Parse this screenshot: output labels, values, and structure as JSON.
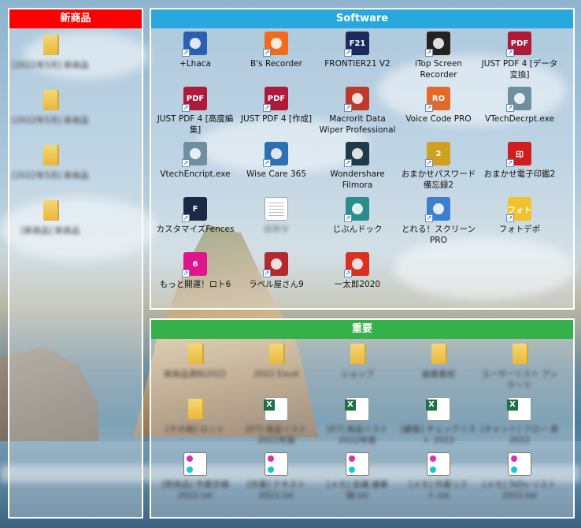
{
  "fences": {
    "new_products": {
      "title": "新商品",
      "header_color": "#ff0000",
      "items": [
        {
          "label": "[2022年5月] 新商品",
          "icon": "folder-icon"
        },
        {
          "label": "[2022年5月] 新商品",
          "icon": "folder-icon"
        },
        {
          "label": "[2022年5月] 新商品",
          "icon": "folder-icon"
        },
        {
          "label": "[新商品] 新商品",
          "icon": "folder-icon"
        }
      ]
    },
    "software": {
      "title": "Software",
      "header_color": "#29a8e0",
      "items": [
        {
          "label": "+Lhaca",
          "icon": "lhaca-icon",
          "color": "#2b5fb0"
        },
        {
          "label": "B's Recorder",
          "icon": "bs-recorder-icon",
          "color": "#f26a1b"
        },
        {
          "label": "FRONTIER21 V2",
          "icon": "frontier21-icon",
          "color": "#1a2a5e",
          "text": "F21"
        },
        {
          "label": "iTop Screen Recorder",
          "icon": "itop-screen-recorder-icon",
          "color": "#222222"
        },
        {
          "label": "JUST PDF 4 [データ変換]",
          "icon": "just-pdf-convert-icon",
          "color": "#b01a3a",
          "text": "PDF"
        },
        {
          "label": "JUST PDF 4 [高度編集]",
          "icon": "just-pdf-advanced-icon",
          "color": "#b01a3a",
          "text": "PDF"
        },
        {
          "label": "JUST PDF 4 [作成]",
          "icon": "just-pdf-create-icon",
          "color": "#b01a3a",
          "text": "PDF"
        },
        {
          "label": "Macrorit Data Wiper Professional",
          "icon": "macrorit-wiper-icon",
          "color": "#c0392b"
        },
        {
          "label": "Voice Code PRO",
          "icon": "voice-code-pro-icon",
          "color": "#e46a2a",
          "text": "RO"
        },
        {
          "label": "VTechDecrpt.exe",
          "icon": "key-icon",
          "color": "#6f8f9f"
        },
        {
          "label": "VtechEncript.exe",
          "icon": "key-icon",
          "color": "#6f8f9f"
        },
        {
          "label": "Wise Care 365",
          "icon": "wise-care-icon",
          "color": "#2d6fb4"
        },
        {
          "label": "Wondershare Filmora",
          "icon": "filmora-icon",
          "color": "#1e3b4a"
        },
        {
          "label": "おまかせパスワード備忘録2",
          "icon": "password-memo-icon",
          "color": "#d0a020",
          "text": "2"
        },
        {
          "label": "おまかせ電子印鑑2",
          "icon": "e-seal-icon",
          "color": "#d01e1e",
          "text": "印"
        },
        {
          "label": "カスタマイズFences",
          "icon": "fences-icon",
          "color": "#1b2a44",
          "text": "F"
        },
        {
          "label": "ロカツ",
          "icon": "blank-doc-icon",
          "color": "#ffffff",
          "blurred": true
        },
        {
          "label": "じぶんドック",
          "icon": "jibun-dock-icon",
          "color": "#2a8c8c"
        },
        {
          "label": "とれる！スクリーンPRO",
          "icon": "toreru-screen-icon",
          "color": "#3c7fd0"
        },
        {
          "label": "フォトデポ",
          "icon": "photo-depo-icon",
          "color": "#f2c12e",
          "text": "フォト"
        },
        {
          "label": "もっと開運！ロト6",
          "icon": "loto6-icon",
          "color": "#e0148c",
          "text": "6"
        },
        {
          "label": "ラベル屋さん9",
          "icon": "label-ya-icon",
          "color": "#b3282d"
        },
        {
          "label": "一太郎2020",
          "icon": "ichitaro-icon",
          "color": "#d93020"
        }
      ]
    },
    "important": {
      "title": "重要",
      "header_color": "#35b04a",
      "items": [
        {
          "label": "新商品資料2022",
          "icon": "folder-icon"
        },
        {
          "label": "2022 Excel",
          "icon": "folder-icon"
        },
        {
          "label": "ショップ",
          "icon": "folder-icon"
        },
        {
          "label": "画像素材",
          "icon": "folder-icon"
        },
        {
          "label": "ユーザーリスト アンケート",
          "icon": "folder-icon"
        },
        {
          "label": "[その他] ロット",
          "icon": "folder-icon"
        },
        {
          "label": "[07] 商品リスト 2022年版",
          "icon": "excel-icon"
        },
        {
          "label": "[07] 商品リスト 2022年版",
          "icon": "excel-icon"
        },
        {
          "label": "[顧客] チェックリスト 2022",
          "icon": "excel-icon"
        },
        {
          "label": "[チャット] フロー 表 2022",
          "icon": "excel-icon"
        },
        {
          "label": "[新商品] 作業手順 2022.txt",
          "icon": "notepad-icon"
        },
        {
          "label": "[作業] テキスト 2022.txt",
          "icon": "notepad-icon"
        },
        {
          "label": "[メモ] 会議 議事録.txt",
          "icon": "notepad-icon"
        },
        {
          "label": "[メモ] 作業リスト.txt",
          "icon": "notepad-icon"
        },
        {
          "label": "[メモ] ToDo リスト 2022.txt",
          "icon": "notepad-icon"
        }
      ]
    }
  }
}
